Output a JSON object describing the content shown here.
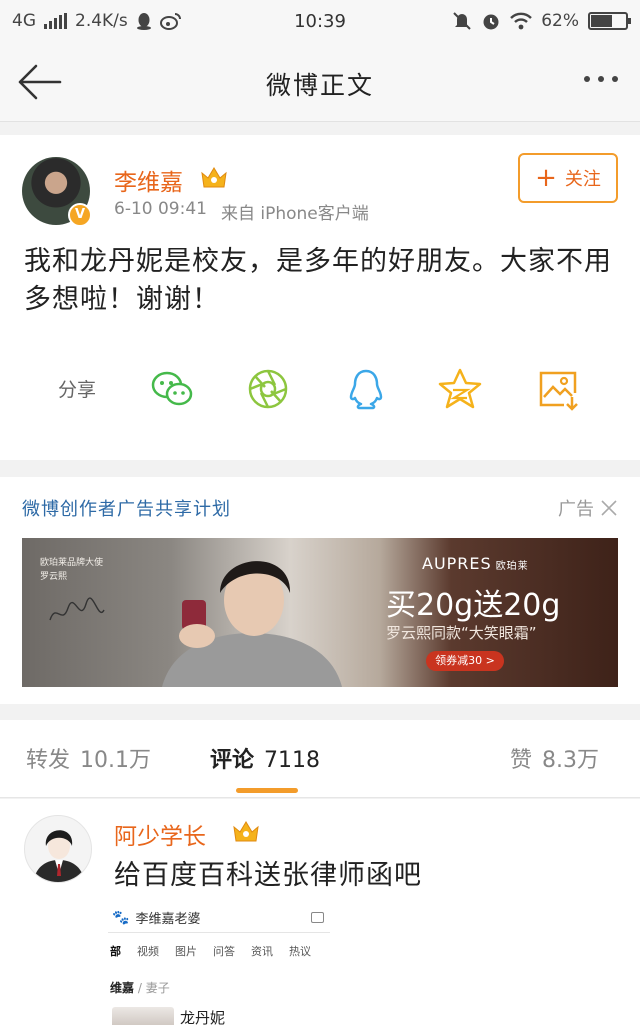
{
  "status_bar": {
    "network": "4G",
    "speed": "2.4K/s",
    "time": "10:39",
    "battery": "62%",
    "battery_level": 0.62
  },
  "navbar": {
    "title": "微博正文"
  },
  "post": {
    "author": "李维嘉",
    "date": "6-10 09:41",
    "source": "来自 iPhone客户端",
    "follow_label": "关注",
    "text": "我和龙丹妮是校友，是多年的好朋友。大家不用多想啦！谢谢！",
    "share_label": "分享",
    "share_icons": [
      "wechat-icon",
      "moments-icon",
      "qq-icon",
      "qzone-icon",
      "save-image-icon"
    ]
  },
  "ad": {
    "title": "微博创作者广告共享计划",
    "tag": "广告",
    "banner": {
      "left_text_1": "欧珀莱品牌大使",
      "left_text_2": "罗云熙",
      "brand": "AUPRES",
      "brand_cn": "欧珀莱",
      "headline": "买20g送20g",
      "subline": "罗云熙同款“大笑眼霜”",
      "coupon": "领券减30 >"
    }
  },
  "stats": {
    "repost_label": "转发",
    "repost_count": "10.1万",
    "comment_label": "评论",
    "comment_count": "7118",
    "like_label": "赞",
    "like_count": "8.3万"
  },
  "comment": {
    "author": "阿少学长",
    "text": "给百度百科送张律师函吧",
    "image": {
      "search_title": "李维嘉老婆",
      "tabs": [
        "部",
        "视频",
        "图片",
        "问答",
        "资讯",
        "热议"
      ],
      "crumb_name": "维嘉",
      "crumb_relation": "/ 妻子",
      "person": "龙丹妮"
    }
  },
  "colors": {
    "accent_orange": "#e8661b",
    "follow_border": "#f39c2b",
    "link_blue": "#2e6aa6"
  }
}
